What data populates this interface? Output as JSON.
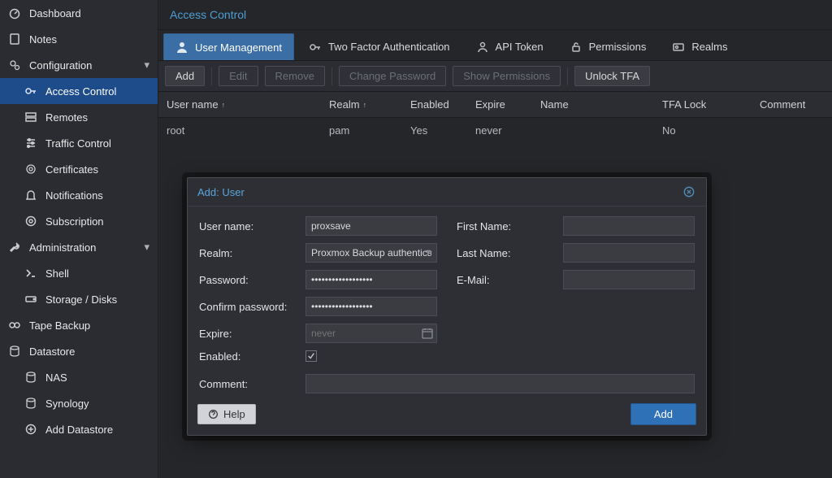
{
  "sidebar": {
    "items": [
      {
        "label": "Dashboard"
      },
      {
        "label": "Notes"
      },
      {
        "label": "Configuration"
      },
      {
        "label": "Access Control"
      },
      {
        "label": "Remotes"
      },
      {
        "label": "Traffic Control"
      },
      {
        "label": "Certificates"
      },
      {
        "label": "Notifications"
      },
      {
        "label": "Subscription"
      },
      {
        "label": "Administration"
      },
      {
        "label": "Shell"
      },
      {
        "label": "Storage / Disks"
      },
      {
        "label": "Tape Backup"
      },
      {
        "label": "Datastore"
      },
      {
        "label": "NAS"
      },
      {
        "label": "Synology"
      },
      {
        "label": "Add Datastore"
      }
    ]
  },
  "panel": {
    "title": "Access Control",
    "tabs": {
      "user_management": "User Management",
      "two_factor": "Two Factor Authentication",
      "api_token": "API Token",
      "permissions": "Permissions",
      "realms": "Realms"
    },
    "toolbar": {
      "add": "Add",
      "edit": "Edit",
      "remove": "Remove",
      "change_password": "Change Password",
      "show_permissions": "Show Permissions",
      "unlock_tfa": "Unlock TFA"
    },
    "columns": {
      "user_name": "User name",
      "realm": "Realm",
      "enabled": "Enabled",
      "expire": "Expire",
      "name": "Name",
      "tfa_lock": "TFA Lock",
      "comment": "Comment"
    },
    "rows": [
      {
        "user": "root",
        "realm": "pam",
        "enabled": "Yes",
        "expire": "never",
        "name": "",
        "tfa_lock": "No",
        "comment": ""
      }
    ]
  },
  "modal": {
    "title": "Add: User",
    "labels": {
      "user_name": "User name:",
      "realm": "Realm:",
      "password": "Password:",
      "confirm_password": "Confirm password:",
      "expire": "Expire:",
      "enabled": "Enabled:",
      "first_name": "First Name:",
      "last_name": "Last Name:",
      "email": "E-Mail:",
      "comment": "Comment:"
    },
    "values": {
      "user_name": "proxsave",
      "realm": "Proxmox Backup authentication server",
      "password": "••••••••••••••••••",
      "confirm_password": "••••••••••••••••••",
      "expire_placeholder": "never",
      "enabled": true,
      "first_name": "",
      "last_name": "",
      "email": "",
      "comment": ""
    },
    "footer": {
      "help": "Help",
      "add": "Add"
    }
  }
}
